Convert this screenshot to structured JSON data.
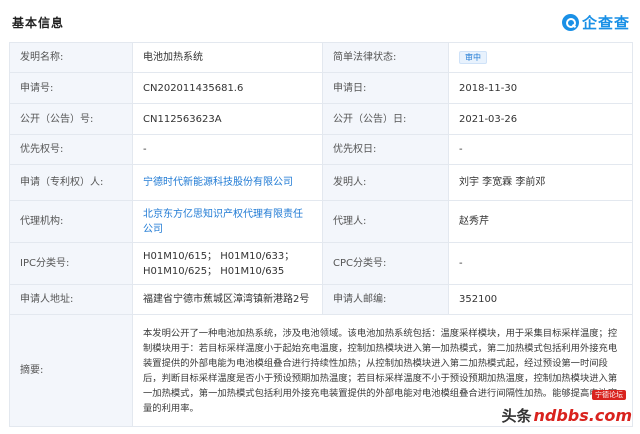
{
  "header": {
    "section_title": "基本信息",
    "brand": {
      "icon": "magnifier-logo-icon",
      "text": "企查查",
      "color": "#1a90e6"
    }
  },
  "rows": [
    {
      "l1": "发明名称:",
      "v1": "电池加热系统",
      "l2": "简单法律状态:",
      "v2": "审中"
    },
    {
      "l1": "申请号:",
      "v1": "CN202011435681.6",
      "l2": "申请日:",
      "v2": "2018-11-30"
    },
    {
      "l1": "公开（公告）号:",
      "v1": "CN112563623A",
      "l2": "公开（公告）日:",
      "v2": "2021-03-26"
    },
    {
      "l1": "优先权号:",
      "v1": "-",
      "l2": "优先权日:",
      "v2": "-"
    },
    {
      "l1": "申请（专利权）人:",
      "v1": "宁德时代新能源科技股份有限公司",
      "l2": "发明人:",
      "v2": "刘宇 李宽霖 李前邓"
    },
    {
      "l1": "代理机构:",
      "v1": "北京东方亿思知识产权代理有限责任公司",
      "l2": "代理人:",
      "v2": "赵秀芹"
    },
    {
      "l1": "IPC分类号:",
      "v1": "H01M10/615； H01M10/633； H01M10/625； H01M10/635",
      "l2": "CPC分类号:",
      "v2": "-"
    },
    {
      "l1": "申请人地址:",
      "v1": "福建省宁德市蕉城区漳湾镇新港路2号",
      "l2": "申请人邮编:",
      "v2": "352100"
    }
  ],
  "abstract": {
    "label": "摘要:",
    "text": "本发明公开了一种电池加热系统，涉及电池领域。该电池加热系统包括：温度采样模块，用于采集目标采样温度；控制模块用于：若目标采样温度小于起始充电温度，控制加热模块进入第一加热模式，第二加热模式包括利用外接充电装置提供的外部电能为电池模组叠合进行持续性加热；从控制加热模块进入第二加热模式起，经过预设第一时间段后，判断目标采样温度是否小于预设预期加热温度；若目标采样温度不小于预设预期加热温度，控制加热模块进入第一加热模式，第一加热模式包括利用外接充电装置提供的外部电能对电池模组叠合进行间隔性加热。能够提高电池容量的利用率。"
  },
  "watermark": {
    "prefix": "头条",
    "logo": "ndbbs.com",
    "tag": "宁德论坛"
  }
}
